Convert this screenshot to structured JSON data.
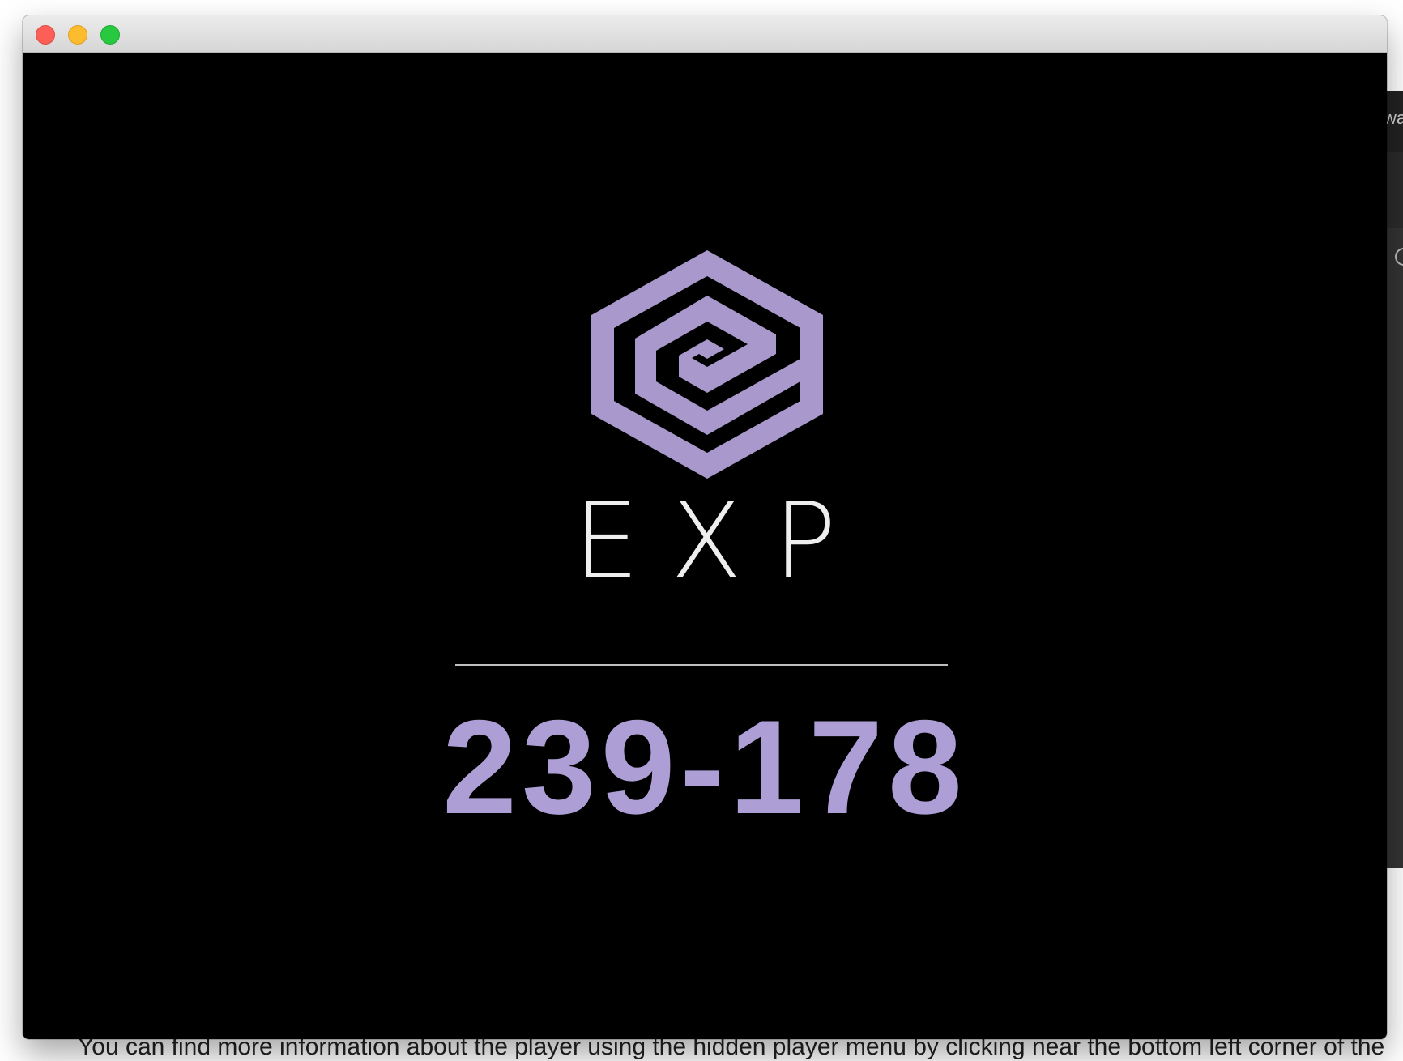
{
  "background": {
    "edge_text": "wa",
    "caption": "You can find more information about the player using the hidden player menu by clicking near the bottom left corner of the"
  },
  "window": {
    "controls": {
      "close": "close-button",
      "minimize": "minimize-button",
      "zoom": "zoom-button"
    }
  },
  "slide": {
    "logo_icon": "exp-hexagon-logo",
    "brand_name": "EXP",
    "code": "239-178",
    "colors": {
      "background": "#000000",
      "accent": "#a898cc",
      "code": "#ad9fd6",
      "brand_text": "#eeeeee",
      "divider": "#bfbfbf"
    }
  }
}
